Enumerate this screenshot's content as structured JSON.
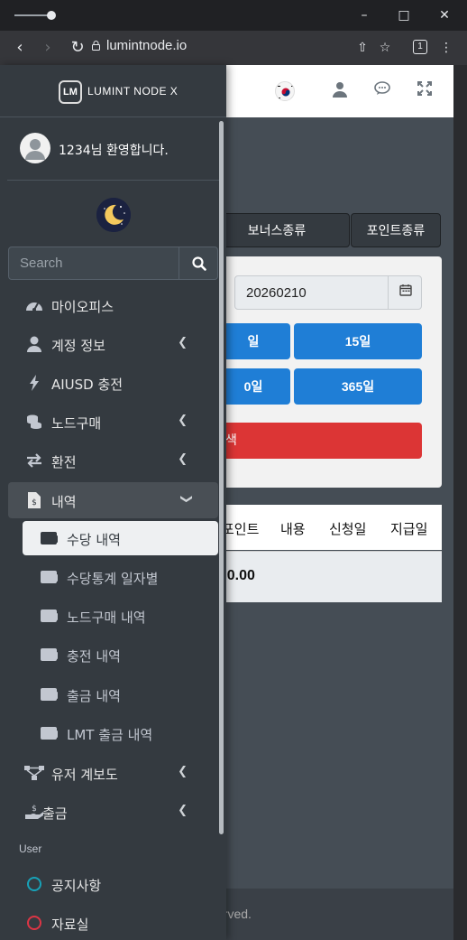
{
  "browser": {
    "url": "lumintnode.io",
    "tab_count": "1"
  },
  "brand": {
    "logo_text": "LM",
    "name": "LUMINT NODE X"
  },
  "user": {
    "welcome": "1234님 환영합니다."
  },
  "search": {
    "placeholder": "Search"
  },
  "menu": {
    "items": [
      {
        "label": "마이오피스",
        "icon": "tachometer-icon"
      },
      {
        "label": "계정 정보",
        "icon": "user-icon"
      },
      {
        "label": "AIUSD 충전",
        "icon": "bolt-icon"
      },
      {
        "label": "노드구매",
        "icon": "coins-icon"
      },
      {
        "label": "환전",
        "icon": "exchange-icon"
      },
      {
        "label": "내역",
        "icon": "file-invoice-icon"
      }
    ],
    "sub_items": [
      {
        "label": "수당 내역"
      },
      {
        "label": "수당통계 일자별"
      },
      {
        "label": "노드구매 내역"
      },
      {
        "label": "충전 내역"
      },
      {
        "label": "출금 내역"
      },
      {
        "label": "LMT 출금 내역"
      }
    ],
    "more_items": [
      {
        "label": "유저 계보도",
        "icon": "sitemap-icon"
      },
      {
        "label": "출금",
        "icon": "hand-holding-dollar-icon"
      }
    ],
    "section_user": "User",
    "user_items": [
      {
        "label": "공지사항",
        "icon": "circle-icon",
        "color": "#17a2b8"
      },
      {
        "label": "자료실",
        "icon": "circle-icon",
        "color": "#dc3545"
      }
    ]
  },
  "main": {
    "tabs": [
      "보너스종류",
      "포인트종류"
    ],
    "date_value": "20260210",
    "periods": [
      "일",
      "15일",
      "0일",
      "365일"
    ],
    "search_label": "색",
    "table_headers": [
      "포인트",
      "내용",
      "신청일",
      "지급일"
    ],
    "total": ": 0.00",
    "footer": "erved."
  },
  "colors": {
    "sidebar_bg": "#343a40",
    "primary": "#1f7ed6",
    "danger": "#dc3535"
  }
}
